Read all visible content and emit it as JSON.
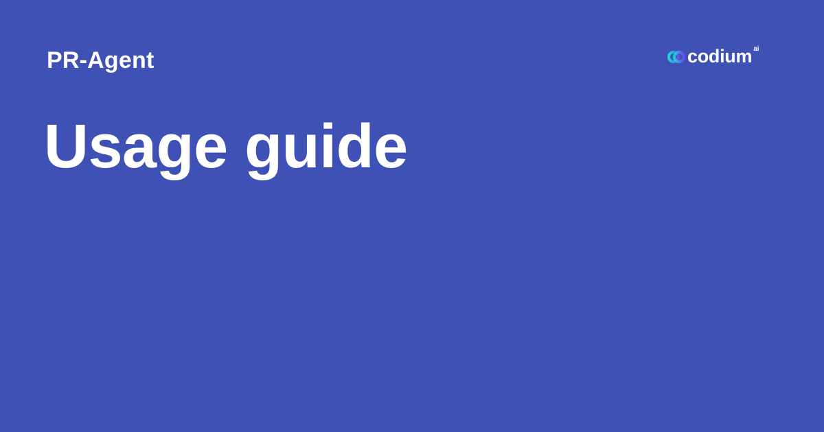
{
  "header": {
    "product_name": "PR-Agent"
  },
  "main": {
    "headline": "Usage guide"
  },
  "logo": {
    "wordmark": "codium",
    "superscript": "ai",
    "mark_icon": "codium-logo-icon"
  },
  "colors": {
    "background": "#3f51b5",
    "text": "#ffffff",
    "logo_gradient_start": "#16e0d3",
    "logo_gradient_end": "#6a4cf5"
  }
}
